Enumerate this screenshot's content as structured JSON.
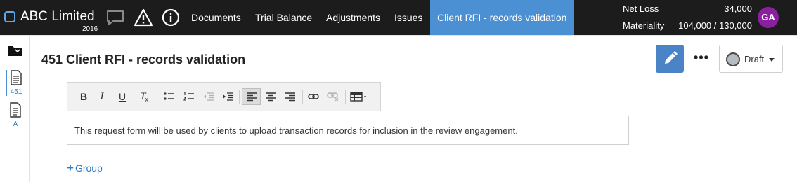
{
  "brand": {
    "name": "ABC Limited",
    "year": "2016"
  },
  "nav": {
    "items": [
      {
        "label": "Documents"
      },
      {
        "label": "Trial Balance"
      },
      {
        "label": "Adjustments"
      },
      {
        "label": "Issues"
      },
      {
        "label": "Client RFI - records validation"
      }
    ],
    "active_index": 4
  },
  "metrics": {
    "net_loss_label": "Net Loss",
    "net_loss_value": "34,000",
    "materiality_label": "Materiality",
    "materiality_value": "104,000 / 130,000"
  },
  "user": {
    "initials": "GA",
    "avatar_color": "#8a1fa0"
  },
  "rail": {
    "docs": [
      {
        "label": "451"
      },
      {
        "label": "A"
      }
    ]
  },
  "page": {
    "title": "451 Client RFI - records validation"
  },
  "status": {
    "label": "Draft"
  },
  "toolbar": {
    "bold": "B",
    "italic": "I",
    "underline": "U",
    "clear_format": "T"
  },
  "editor": {
    "content": "This request form will be used by clients to upload transaction records for inclusion in the review engagement."
  },
  "add_group": {
    "label": "Group"
  },
  "colors": {
    "accent": "#4a90d2",
    "topbar": "#1c1c1c",
    "link": "#2f79c4"
  },
  "icons": [
    "comment-icon",
    "warning-icon",
    "info-icon",
    "folder-icon",
    "document-icon",
    "pencil-icon",
    "more-icon",
    "bullet-list-icon",
    "numbered-list-icon",
    "outdent-icon",
    "indent-icon",
    "align-left-icon",
    "align-center-icon",
    "align-right-icon",
    "link-icon",
    "unlink-icon",
    "table-icon",
    "plus-icon"
  ]
}
